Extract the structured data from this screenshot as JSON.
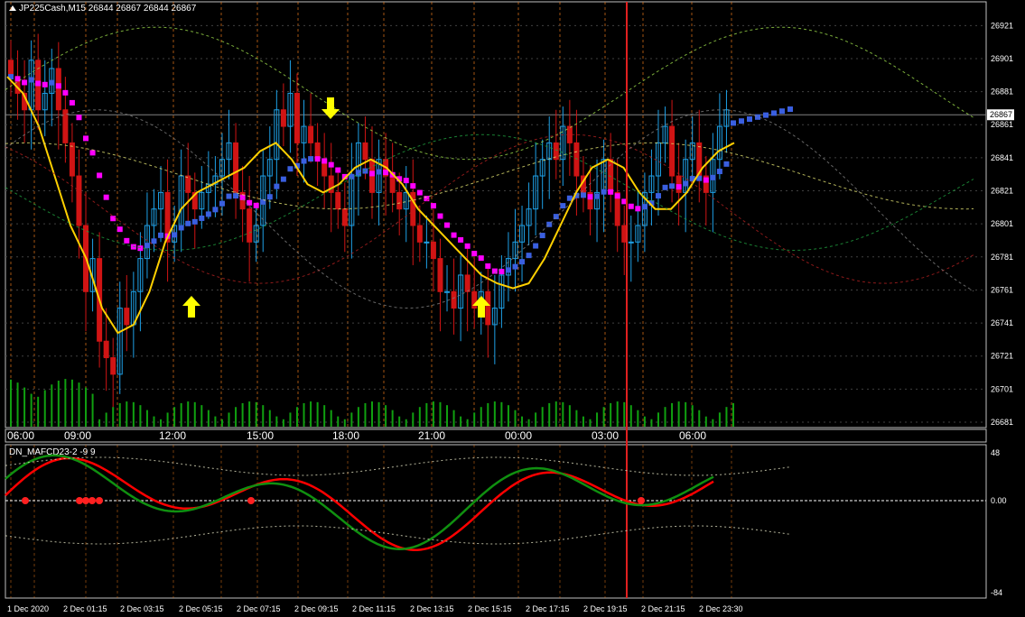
{
  "window": {
    "symbol_info": "JP225Cash,M15  26844 26867 26844 26867",
    "current_price_label": "26867"
  },
  "indicator": {
    "title": "DN_MAFCD23-2 -9 9",
    "scale_labels": [
      "48",
      "0.00",
      "-84"
    ],
    "colors": {
      "fast": "#ff0000",
      "slow": "#109010",
      "band": "#e0e0c0"
    }
  },
  "colors": {
    "bull_candle": "#1ea0e6",
    "bear_candle": "#d01414",
    "ma_down": "#ff00ff",
    "ma_up": "#3a5fe0",
    "ma_yellow": "#ffd000",
    "volume": "#10a010",
    "vline_red": "#e02020",
    "arrow": "#ffff00",
    "grid": "#e87a1a"
  },
  "price_axis": {
    "labels": [
      "26921",
      "26901",
      "26881",
      "26861",
      "26841",
      "26821",
      "26801",
      "26781",
      "26761",
      "26741",
      "26721",
      "26701",
      "26681"
    ]
  },
  "time_axis": {
    "labels": [
      "06:00",
      "09:00",
      "12:00",
      "15:00",
      "18:00",
      "21:00",
      "00:00",
      "03:00",
      "06:00"
    ]
  },
  "date_axis": {
    "labels": [
      "1 Dec 2020",
      "2 Dec 01:15",
      "2 Dec 03:15",
      "2 Dec 05:15",
      "2 Dec 07:15",
      "2 Dec 09:15",
      "2 Dec 11:15",
      "2 Dec 13:15",
      "2 Dec 15:15",
      "2 Dec 17:15",
      "2 Dec 19:15",
      "2 Dec 21:15",
      "2 Dec 23:30"
    ]
  },
  "icons": {
    "up_arrow": "up-arrow-icon",
    "down_arrow": "down-arrow-icon"
  },
  "chart_data": {
    "type": "candlestick",
    "timeframe": "M15",
    "ylim": [
      26681,
      26931
    ],
    "closes": [
      26890,
      26880,
      26870,
      26900,
      26870,
      26880,
      26895,
      26870,
      26850,
      26830,
      26800,
      26760,
      26780,
      26730,
      26720,
      26710,
      26750,
      26740,
      26760,
      26780,
      26800,
      26810,
      26820,
      26790,
      26800,
      26830,
      26820,
      26810,
      26820,
      26825,
      26830,
      26840,
      26850,
      26820,
      26810,
      26790,
      26800,
      26830,
      26840,
      26870,
      26860,
      26880,
      26850,
      26860,
      26850,
      26840,
      26830,
      26820,
      26810,
      26800,
      26830,
      26850,
      26840,
      26820,
      26840,
      26830,
      26820,
      26810,
      26820,
      26800,
      26790,
      26790,
      26780,
      26760,
      26760,
      26750,
      26770,
      26760,
      26750,
      26760,
      26740,
      26750,
      26770,
      26780,
      26790,
      26800,
      26810,
      26830,
      26840,
      26850,
      26840,
      26860,
      26850,
      26830,
      26820,
      26810,
      26820,
      26840,
      26820,
      26800,
      26790,
      26790,
      26800,
      26820,
      26830,
      26850,
      26860,
      26830,
      26820,
      26840,
      26850,
      26830,
      26820,
      26840,
      26860,
      26870
    ],
    "series": [
      {
        "name": "",
        "values": [
          26890,
          26880,
          26860,
          26830,
          26800,
          26780,
          26750,
          26735,
          26740,
          26760,
          26790,
          26810,
          26820,
          26825,
          26830,
          26835,
          26845,
          26850,
          26840,
          26825,
          26820,
          26825,
          26835,
          26840,
          26835,
          26825,
          26810,
          26800,
          26790,
          26780,
          26770,
          26765,
          26762,
          26765,
          26780,
          26800,
          26820,
          26835,
          26840,
          26835,
          26820,
          26810,
          26810,
          26820,
          26835,
          26845,
          26850
        ]
      }
    ],
    "arrows": [
      {
        "dir": "up",
        "index": 30
      },
      {
        "dir": "down",
        "index": 56
      },
      {
        "dir": "up",
        "index": 80
      }
    ]
  }
}
